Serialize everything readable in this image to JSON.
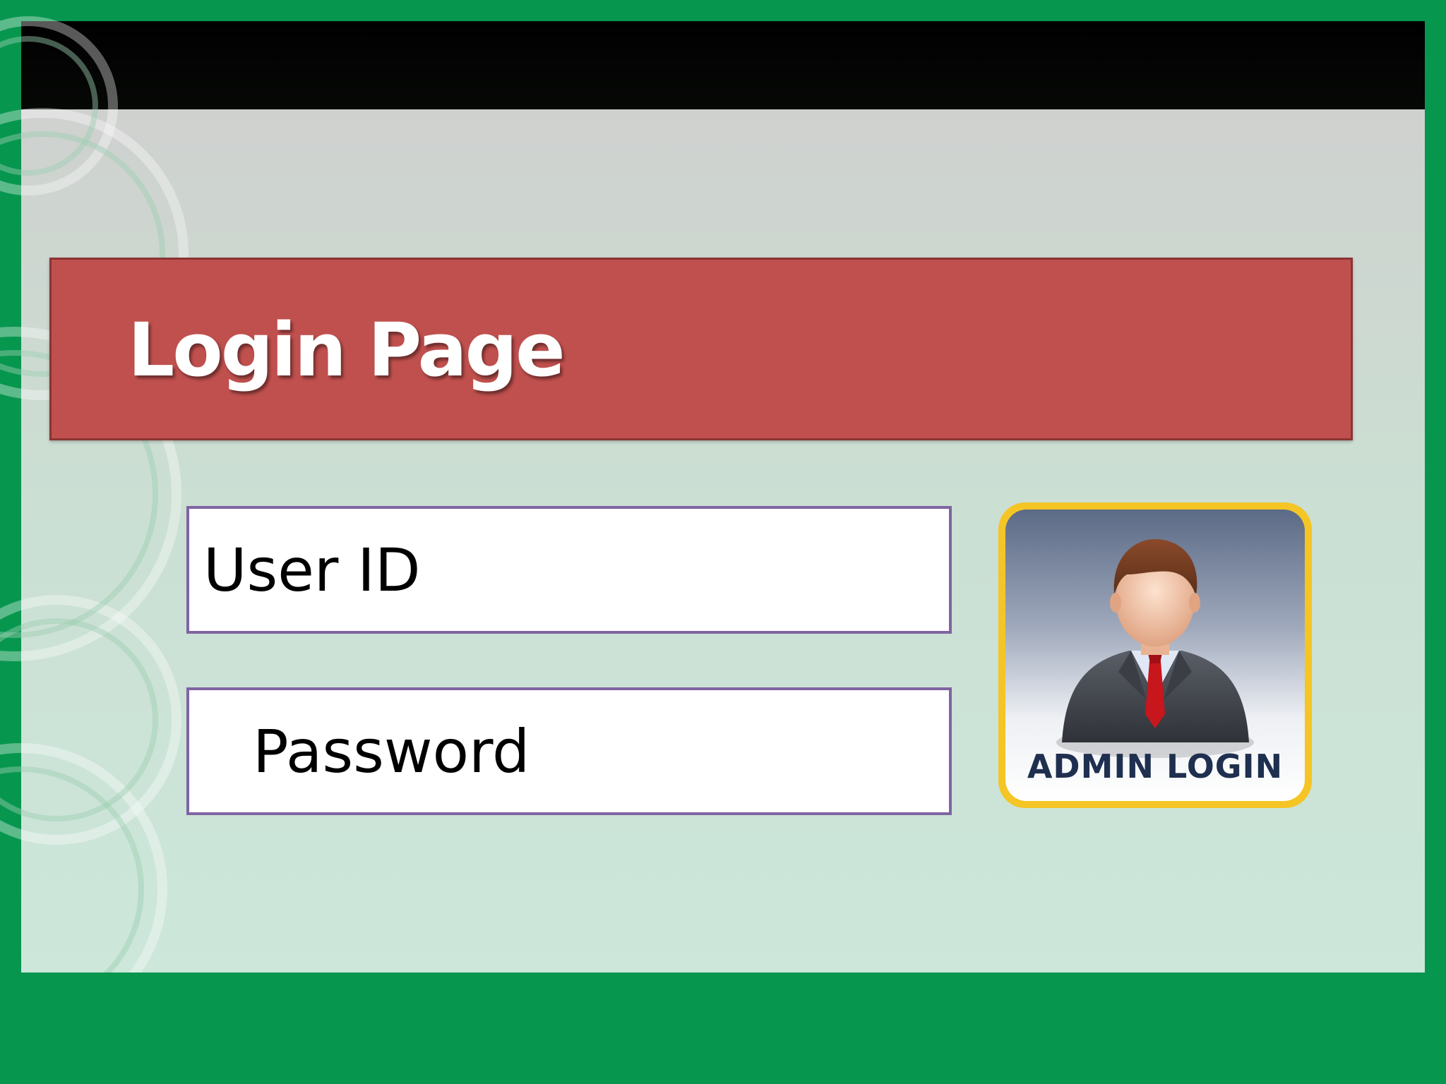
{
  "slide": {
    "title": "Login Page",
    "colors": {
      "frame": "#07964e",
      "top_bar": "#000000",
      "banner": "#c0504e",
      "field_border": "#8064a2",
      "badge_border": "#f4c525",
      "badge_text": "#1f2f4f"
    }
  },
  "form": {
    "user_id_label": "User ID",
    "password_label": "Password"
  },
  "admin_badge": {
    "label": "ADMIN LOGIN",
    "icon": "businessman-avatar-icon"
  }
}
